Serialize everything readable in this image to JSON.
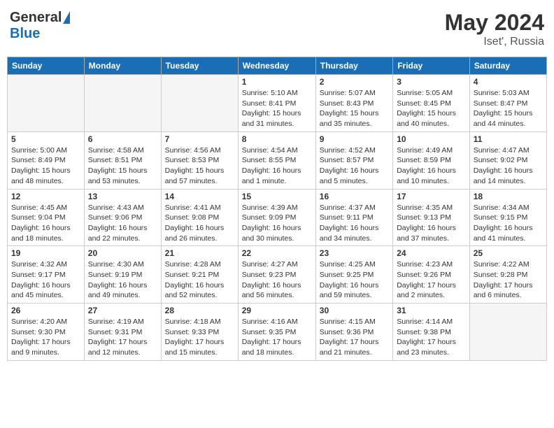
{
  "header": {
    "logo_general": "General",
    "logo_blue": "Blue",
    "title": "May 2024",
    "subtitle": "Iset', Russia"
  },
  "weekdays": [
    "Sunday",
    "Monday",
    "Tuesday",
    "Wednesday",
    "Thursday",
    "Friday",
    "Saturday"
  ],
  "weeks": [
    [
      {
        "day": "",
        "info": ""
      },
      {
        "day": "",
        "info": ""
      },
      {
        "day": "",
        "info": ""
      },
      {
        "day": "1",
        "info": "Sunrise: 5:10 AM\nSunset: 8:41 PM\nDaylight: 15 hours\nand 31 minutes."
      },
      {
        "day": "2",
        "info": "Sunrise: 5:07 AM\nSunset: 8:43 PM\nDaylight: 15 hours\nand 35 minutes."
      },
      {
        "day": "3",
        "info": "Sunrise: 5:05 AM\nSunset: 8:45 PM\nDaylight: 15 hours\nand 40 minutes."
      },
      {
        "day": "4",
        "info": "Sunrise: 5:03 AM\nSunset: 8:47 PM\nDaylight: 15 hours\nand 44 minutes."
      }
    ],
    [
      {
        "day": "5",
        "info": "Sunrise: 5:00 AM\nSunset: 8:49 PM\nDaylight: 15 hours\nand 48 minutes."
      },
      {
        "day": "6",
        "info": "Sunrise: 4:58 AM\nSunset: 8:51 PM\nDaylight: 15 hours\nand 53 minutes."
      },
      {
        "day": "7",
        "info": "Sunrise: 4:56 AM\nSunset: 8:53 PM\nDaylight: 15 hours\nand 57 minutes."
      },
      {
        "day": "8",
        "info": "Sunrise: 4:54 AM\nSunset: 8:55 PM\nDaylight: 16 hours\nand 1 minute."
      },
      {
        "day": "9",
        "info": "Sunrise: 4:52 AM\nSunset: 8:57 PM\nDaylight: 16 hours\nand 5 minutes."
      },
      {
        "day": "10",
        "info": "Sunrise: 4:49 AM\nSunset: 8:59 PM\nDaylight: 16 hours\nand 10 minutes."
      },
      {
        "day": "11",
        "info": "Sunrise: 4:47 AM\nSunset: 9:02 PM\nDaylight: 16 hours\nand 14 minutes."
      }
    ],
    [
      {
        "day": "12",
        "info": "Sunrise: 4:45 AM\nSunset: 9:04 PM\nDaylight: 16 hours\nand 18 minutes."
      },
      {
        "day": "13",
        "info": "Sunrise: 4:43 AM\nSunset: 9:06 PM\nDaylight: 16 hours\nand 22 minutes."
      },
      {
        "day": "14",
        "info": "Sunrise: 4:41 AM\nSunset: 9:08 PM\nDaylight: 16 hours\nand 26 minutes."
      },
      {
        "day": "15",
        "info": "Sunrise: 4:39 AM\nSunset: 9:09 PM\nDaylight: 16 hours\nand 30 minutes."
      },
      {
        "day": "16",
        "info": "Sunrise: 4:37 AM\nSunset: 9:11 PM\nDaylight: 16 hours\nand 34 minutes."
      },
      {
        "day": "17",
        "info": "Sunrise: 4:35 AM\nSunset: 9:13 PM\nDaylight: 16 hours\nand 37 minutes."
      },
      {
        "day": "18",
        "info": "Sunrise: 4:34 AM\nSunset: 9:15 PM\nDaylight: 16 hours\nand 41 minutes."
      }
    ],
    [
      {
        "day": "19",
        "info": "Sunrise: 4:32 AM\nSunset: 9:17 PM\nDaylight: 16 hours\nand 45 minutes."
      },
      {
        "day": "20",
        "info": "Sunrise: 4:30 AM\nSunset: 9:19 PM\nDaylight: 16 hours\nand 49 minutes."
      },
      {
        "day": "21",
        "info": "Sunrise: 4:28 AM\nSunset: 9:21 PM\nDaylight: 16 hours\nand 52 minutes."
      },
      {
        "day": "22",
        "info": "Sunrise: 4:27 AM\nSunset: 9:23 PM\nDaylight: 16 hours\nand 56 minutes."
      },
      {
        "day": "23",
        "info": "Sunrise: 4:25 AM\nSunset: 9:25 PM\nDaylight: 16 hours\nand 59 minutes."
      },
      {
        "day": "24",
        "info": "Sunrise: 4:23 AM\nSunset: 9:26 PM\nDaylight: 17 hours\nand 2 minutes."
      },
      {
        "day": "25",
        "info": "Sunrise: 4:22 AM\nSunset: 9:28 PM\nDaylight: 17 hours\nand 6 minutes."
      }
    ],
    [
      {
        "day": "26",
        "info": "Sunrise: 4:20 AM\nSunset: 9:30 PM\nDaylight: 17 hours\nand 9 minutes."
      },
      {
        "day": "27",
        "info": "Sunrise: 4:19 AM\nSunset: 9:31 PM\nDaylight: 17 hours\nand 12 minutes."
      },
      {
        "day": "28",
        "info": "Sunrise: 4:18 AM\nSunset: 9:33 PM\nDaylight: 17 hours\nand 15 minutes."
      },
      {
        "day": "29",
        "info": "Sunrise: 4:16 AM\nSunset: 9:35 PM\nDaylight: 17 hours\nand 18 minutes."
      },
      {
        "day": "30",
        "info": "Sunrise: 4:15 AM\nSunset: 9:36 PM\nDaylight: 17 hours\nand 21 minutes."
      },
      {
        "day": "31",
        "info": "Sunrise: 4:14 AM\nSunset: 9:38 PM\nDaylight: 17 hours\nand 23 minutes."
      },
      {
        "day": "",
        "info": ""
      }
    ]
  ]
}
